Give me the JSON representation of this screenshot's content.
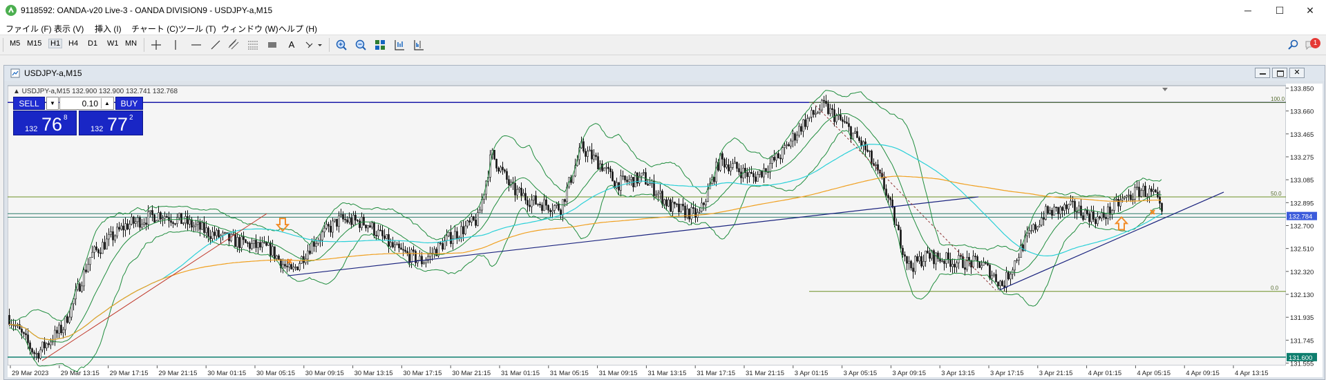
{
  "window": {
    "title": "9118592: OANDA-v20 Live-3 - OANDA DIVISION9 - USDJPY-a,M15",
    "minimize_label": "─",
    "maximize_label": "☐",
    "close_label": "✕"
  },
  "menu": [
    "ファイル (F)",
    "表示 (V)",
    "挿入 (I)",
    "チャート (C)",
    "ツール (T)",
    "ウィンドウ (W)",
    "ヘルプ (H)"
  ],
  "timeframes": [
    "M5",
    "M15",
    "H1",
    "H4",
    "D1",
    "W1",
    "MN"
  ],
  "toolbar": {
    "text_tool_label": "A",
    "notification_count": "1"
  },
  "chart_window": {
    "title": "USDJPY-a,M15"
  },
  "chart_data": {
    "type": "candlestick",
    "symbol_label": "USDJPY-a,M15",
    "ohlc_label": "132.900 132.900 132.741 132.768",
    "price_ticks": [
      "133.850",
      "133.660",
      "133.465",
      "133.275",
      "133.085",
      "132.895",
      "132.700",
      "132.510",
      "132.320",
      "132.130",
      "131.935",
      "131.745",
      "131.555"
    ],
    "time_ticks": [
      "29 Mar 2023",
      "29 Mar 13:15",
      "29 Mar 17:15",
      "29 Mar 21:15",
      "30 Mar 01:15",
      "30 Mar 05:15",
      "30 Mar 09:15",
      "30 Mar 13:15",
      "30 Mar 17:15",
      "30 Mar 21:15",
      "31 Mar 01:15",
      "31 Mar 05:15",
      "31 Mar 09:15",
      "31 Mar 13:15",
      "31 Mar 17:15",
      "31 Mar 21:15",
      "3 Apr 01:15",
      "3 Apr 05:15",
      "3 Apr 09:15",
      "3 Apr 13:15",
      "3 Apr 17:15",
      "3 Apr 21:15",
      "4 Apr 01:15",
      "4 Apr 05:15",
      "4 Apr 09:15",
      "4 Apr 13:15"
    ],
    "ylim": [
      131.53,
      133.87
    ],
    "current_price_label": "132.784",
    "support_label": "131.600",
    "fibo_labels": [
      "100.0",
      "50.0",
      "0.0"
    ],
    "fibo_levels": [
      133.73,
      132.94,
      132.15
    ],
    "horizontal_levels": [
      133.73,
      132.8,
      132.77,
      131.6
    ],
    "colors": {
      "background": "#f5f5f5",
      "candle": "#111111",
      "bollinger": "#1e8c3c",
      "ma_fast": "#2ad0d8",
      "ma_slow": "#f0a020",
      "trend": "#1a237e",
      "trend_red": "#c0392b",
      "arrow": "#f28c28",
      "price_tag": "#3b5bdb"
    }
  },
  "trade_panel": {
    "sell_label": "SELL",
    "buy_label": "BUY",
    "lot_value": "0.10",
    "sell_prefix": "132",
    "sell_big": "76",
    "sell_sup": "8",
    "buy_prefix": "132",
    "buy_big": "77",
    "buy_sup": "2"
  }
}
